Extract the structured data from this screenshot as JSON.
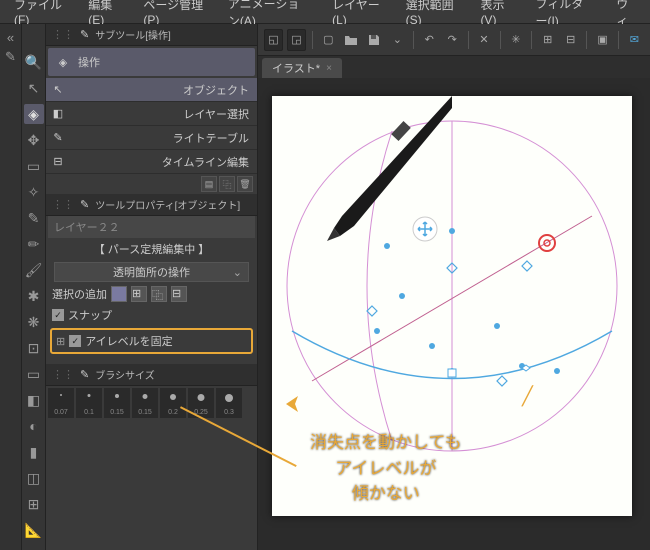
{
  "menu": [
    "ファイル(F)",
    "編集(E)",
    "ページ管理(P)",
    "アニメーション(A)",
    "レイヤー(L)",
    "選択範囲(S)",
    "表示(V)",
    "フィルター(I)",
    "ウィ"
  ],
  "subtool_panel": {
    "title": "サブツール[操作]",
    "main_tool": "操作",
    "items": [
      "オブジェクト",
      "レイヤー選択",
      "ライトテーブル",
      "タイムライン編集"
    ]
  },
  "prop_panel": {
    "title": "ツールプロパティ[オブジェクト]",
    "layer": "レイヤー２２",
    "editing": "【 パース定規編集中 】",
    "dropdown": "透明箇所の操作",
    "addsel": "選択の追加",
    "snap": "スナップ",
    "fix_eyelevel": "アイレベルを固定",
    "brush_title": "ブラシサイズ",
    "brush_sizes": [
      "0.07",
      "0.1",
      "0.15",
      "0.15",
      "0.2",
      "0.25",
      "0.3"
    ]
  },
  "tab": {
    "name": "イラスト*"
  },
  "annotation": {
    "text1": "消失点を動かしても",
    "text2": "アイレベルが",
    "text3": "傾かない"
  }
}
